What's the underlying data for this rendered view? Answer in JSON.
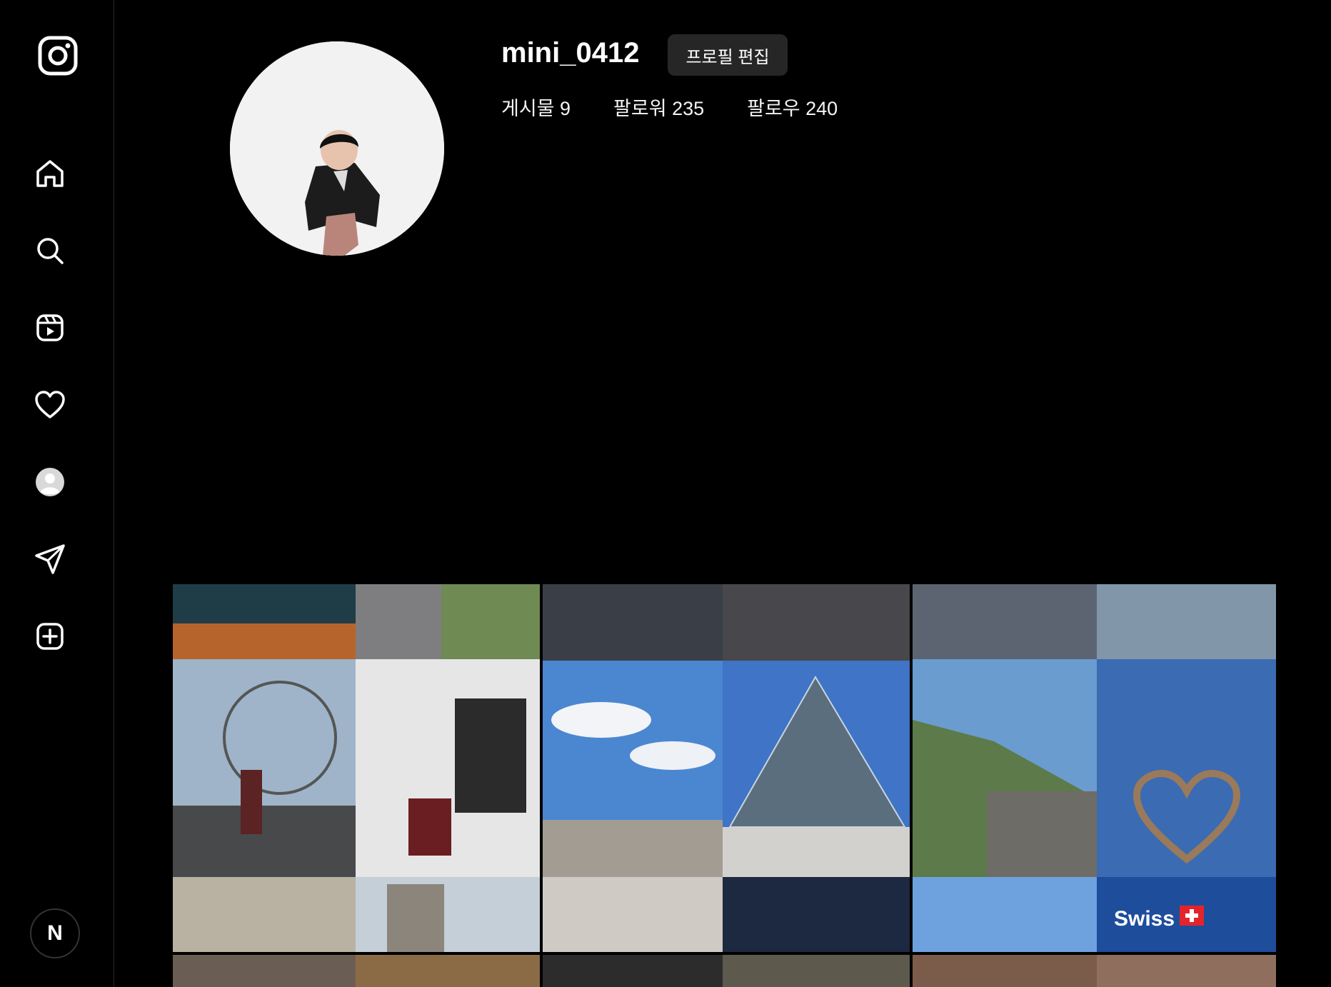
{
  "sidebar": {
    "logo_icon": "instagram-icon",
    "nav_icons": [
      "home-icon",
      "search-icon",
      "reels-icon",
      "heart-icon",
      "profile-icon",
      "send-icon",
      "create-icon"
    ],
    "badge_label": "N"
  },
  "profile": {
    "username": "mini_0412",
    "edit_button_label": "프로필 편집",
    "stats": {
      "posts": "게시물 9",
      "followers": "팔로워 235",
      "following": "팔로우 240"
    }
  },
  "posts": {
    "tile_labels": {
      "swiss_sign": "Swiss"
    }
  },
  "colors": {
    "background": "#000000",
    "button": "#262626",
    "text": "#ffffff"
  }
}
